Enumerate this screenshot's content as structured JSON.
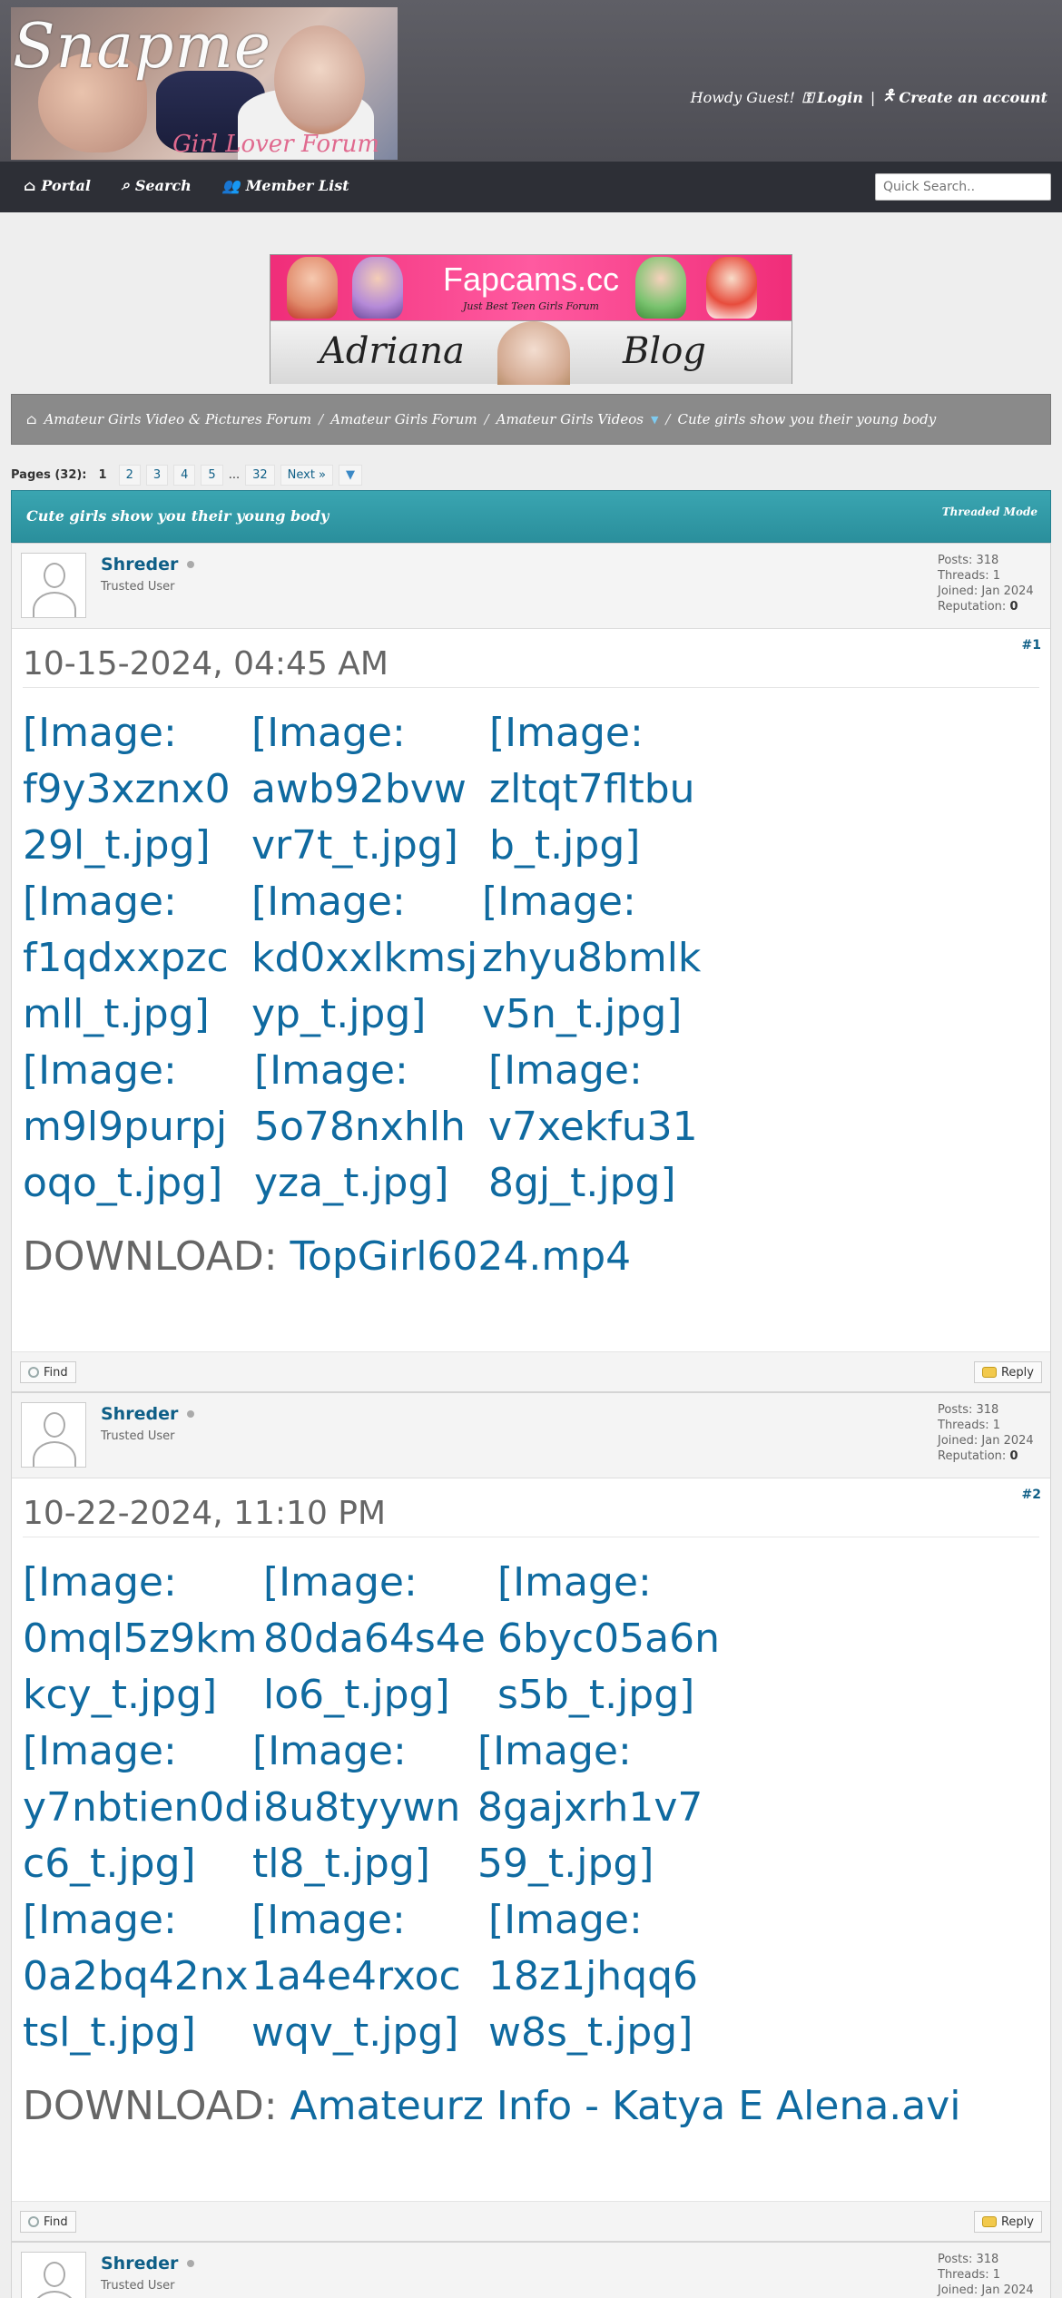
{
  "site": {
    "logo_text": "Snapme",
    "logo_subtitle": "Girl Lover Forum",
    "greeting": "Howdy Guest!",
    "login": "Login",
    "separator": "|",
    "create_account": "Create an account"
  },
  "nav": {
    "portal": "Portal",
    "search": "Search",
    "member_list": "Member List",
    "quick_search_placeholder": "Quick Search.."
  },
  "banner": {
    "top_title": "Fapcams.cc",
    "top_subtitle": "Just Best Teen Girls Forum",
    "bottom_left": "Adriana",
    "bottom_right": "Blog"
  },
  "breadcrumb": {
    "items": [
      "Amateur Girls Video & Pictures Forum",
      "Amateur Girls Forum",
      "Amateur Girls Videos",
      "Cute girls show you their young body"
    ],
    "sep": "/"
  },
  "pagination": {
    "label": "Pages (32):",
    "pages": [
      "1",
      "2",
      "3",
      "4",
      "5"
    ],
    "ellipsis": "...",
    "last": "32",
    "next": "Next »"
  },
  "thread": {
    "title": "Cute girls show you their young body",
    "mode": "Threaded Mode"
  },
  "posts": [
    {
      "author": "Shreder",
      "user_title": "Trusted User",
      "stats": {
        "posts": "Posts: 318",
        "threads": "Threads: 1",
        "joined": "Joined: Jan 2024",
        "reputation_label": "Reputation:",
        "reputation": "0"
      },
      "date": "10-15-2024, 04:45 AM",
      "number": "#1",
      "images": [
        [
          "[Image:\nf9y3xznx0\n29l_t.jpg]",
          "[Image:\nawb92bvw\nvr7t_t.jpg]",
          "[Image:\nzltqt7fltbu\nb_t.jpg]"
        ],
        [
          "[Image:\nf1qdxxpzc\nmll_t.jpg]",
          "[Image:\nkd0xxlkmsj\nyp_t.jpg]",
          "[Image:\nzhyu8bmlk\nv5n_t.jpg]"
        ],
        [
          "[Image:\nm9l9purpj\noqo_t.jpg]",
          "[Image:\n5o78nxhlh\nyza_t.jpg]",
          "[Image:\nv7xekfu31\n8gj_t.jpg]"
        ]
      ],
      "download_label": "DOWNLOAD:",
      "download_link": "TopGirl6024.mp4",
      "find": "Find",
      "reply": "Reply"
    },
    {
      "author": "Shreder",
      "user_title": "Trusted User",
      "stats": {
        "posts": "Posts: 318",
        "threads": "Threads: 1",
        "joined": "Joined: Jan 2024",
        "reputation_label": "Reputation:",
        "reputation": "0"
      },
      "date": "10-22-2024, 11:10 PM",
      "number": "#2",
      "images": [
        [
          "[Image:\n0mql5z9km\nkcy_t.jpg]",
          "[Image:\n80da64s4e\nlo6_t.jpg]",
          "[Image:\n6byc05a6n\ns5b_t.jpg]"
        ],
        [
          "[Image:\ny7nbtien0d\nc6_t.jpg]",
          "[Image:\ni8u8tyywn\ntl8_t.jpg]",
          "[Image:\n8gajxrh1v7\n59_t.jpg]"
        ],
        [
          "[Image:\n0a2bq42nx\ntsl_t.jpg]",
          "[Image:\n1a4e4rxoc\nwqv_t.jpg]",
          "[Image:\n18z1jhqq6\nw8s_t.jpg]"
        ]
      ],
      "download_label": "DOWNLOAD:",
      "download_link": "Amateurz Info - Katya E Alena.avi",
      "find": "Find",
      "reply": "Reply"
    },
    {
      "author": "Shreder",
      "user_title": "Trusted User",
      "stats": {
        "posts": "Posts: 318",
        "threads": "Threads: 1",
        "joined": "Joined: Jan 2024"
      }
    }
  ]
}
